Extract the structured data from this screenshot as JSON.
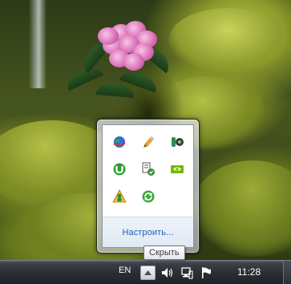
{
  "overflow_panel": {
    "customize_label": "Настроить...",
    "icons": [
      {
        "name": "globe-network-icon"
      },
      {
        "name": "pencil-tool-icon"
      },
      {
        "name": "audio-driver-icon"
      },
      {
        "name": "utorrent-icon"
      },
      {
        "name": "document-sync-icon"
      },
      {
        "name": "nvidia-icon"
      },
      {
        "name": "person-update-icon"
      },
      {
        "name": "green-refresh-icon"
      }
    ]
  },
  "tooltip": {
    "text": "Скрыть"
  },
  "taskbar": {
    "language": "EN",
    "clock": "11:28"
  },
  "colors": {
    "link": "#1f5fbf",
    "taskbar": "#2a2d33"
  }
}
